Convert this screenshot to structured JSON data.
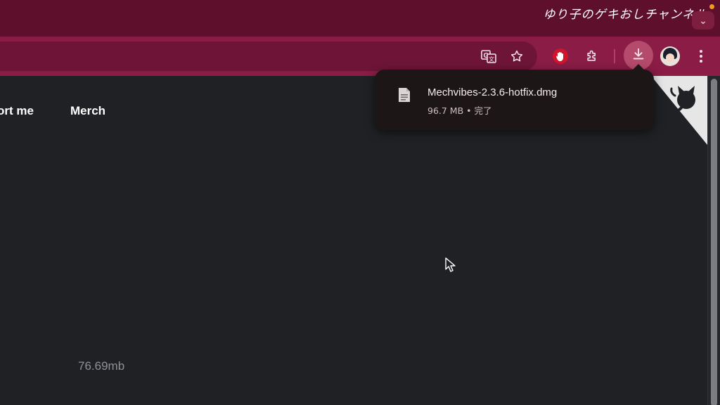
{
  "colors": {
    "tabstrip": "#5e0f2c",
    "toolbar": "#8a1c46",
    "page_background": "#1f2125",
    "download_bubble": "#1d1617"
  },
  "titlebar": {
    "channel_title": "ゆり子のゲキおしチャンネル"
  },
  "toolbar": {
    "icons": [
      "translate-icon",
      "star-icon",
      "adblock-stop-icon",
      "extensions-icon",
      "download-icon",
      "profile-avatar",
      "menu-icon"
    ]
  },
  "page": {
    "nav": {
      "support_label": "ort me",
      "merch_label": "Merch"
    },
    "file_size": "76.69mb"
  },
  "download_bubble": {
    "file_name": "Mechvibes-2.3.6-hotfix.dmg",
    "file_size": "96.7 MB",
    "separator": "•",
    "status": "完了"
  }
}
